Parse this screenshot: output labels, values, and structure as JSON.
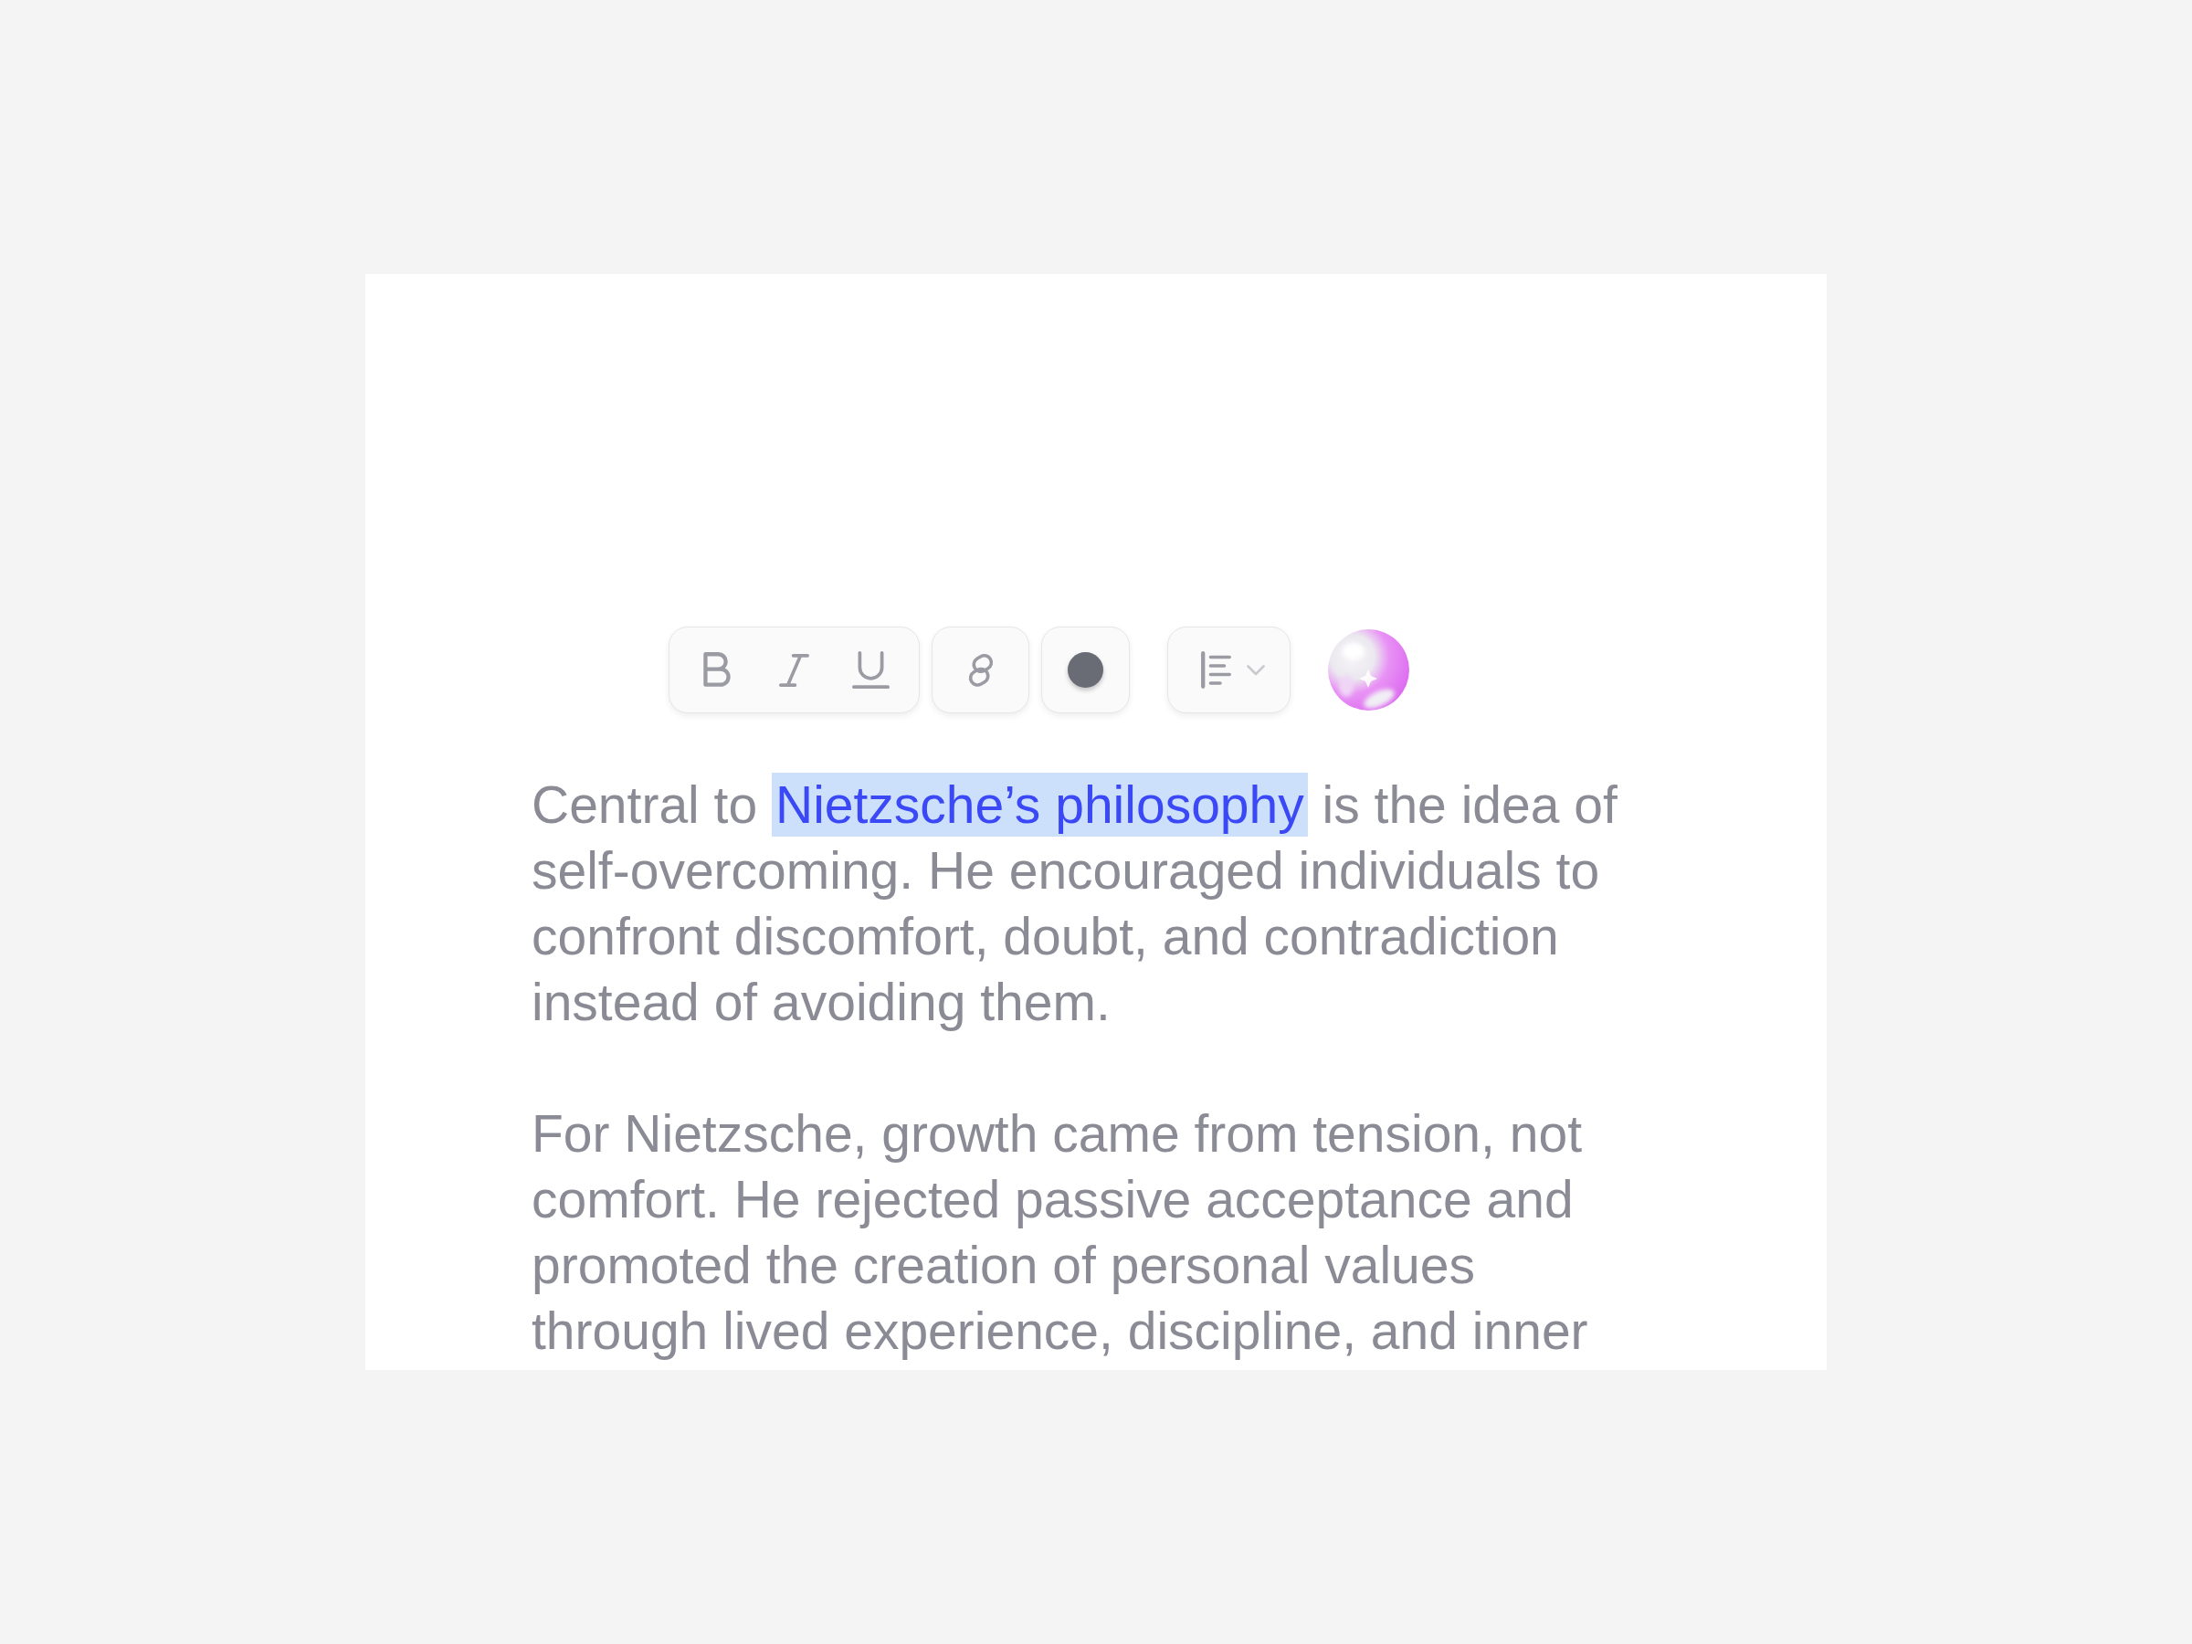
{
  "toolbar": [
    {
      "kind": "format",
      "buttons": [
        {
          "kind": "bold"
        },
        {
          "kind": "italic"
        },
        {
          "kind": "underline"
        }
      ]
    },
    {
      "kind": "link"
    },
    {
      "kind": "color",
      "color": "#696b75"
    },
    {
      "kind": "align"
    },
    {
      "kind": "assistant"
    }
  ],
  "paragraphs": [
    {
      "segments": [
        {
          "text": "Central to ",
          "selected": false
        },
        {
          "text": "Nietzsche’s philosophy",
          "selected": true
        },
        {
          "text": " is the idea of self-overcoming. He encouraged individuals to confront discomfort, doubt, and contradiction instead of avoiding them.",
          "selected": false
        }
      ]
    },
    {
      "segments": [
        {
          "text": "For Nietzsche, growth came from tension, not comfort. He rejected passive acceptance and promoted the creation of personal values through lived experience, discipline, and inner",
          "selected": false
        }
      ]
    }
  ]
}
